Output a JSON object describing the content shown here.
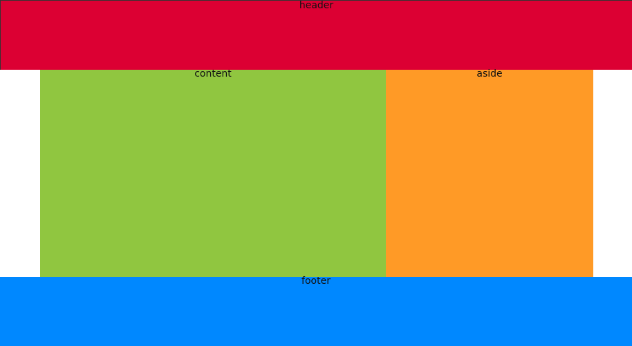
{
  "header": {
    "label": "header",
    "color": "#dc0033"
  },
  "content": {
    "label": "content",
    "color": "#90c640"
  },
  "aside": {
    "label": "aside",
    "color": "#ff9a26"
  },
  "footer": {
    "label": "footer",
    "color": "#0088ff"
  }
}
